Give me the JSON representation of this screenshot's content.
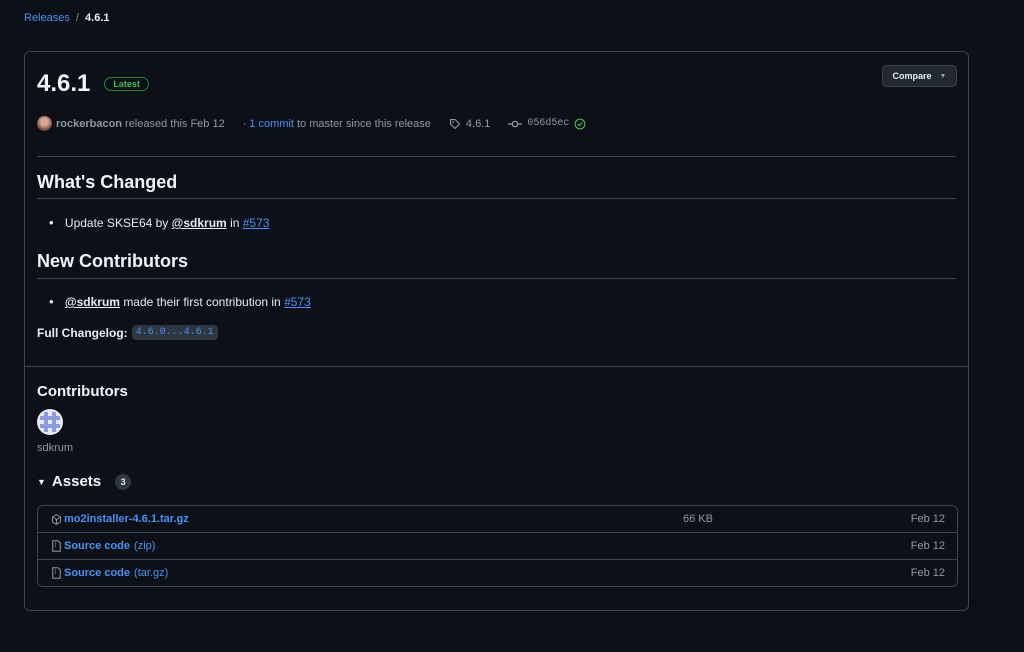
{
  "breadcrumb": {
    "parent": "Releases",
    "separator": "/",
    "current": "4.6.1"
  },
  "release": {
    "title": "4.6.1",
    "badge": "Latest",
    "compare_label": "Compare",
    "author": "rockerbacon",
    "released_text": "released this Feb 12",
    "commits_prefix": "·",
    "commits_link": "1 commit",
    "commits_suffix": "to master since this release",
    "tag": "4.6.1",
    "commit_sha": "056d5ec"
  },
  "notes": {
    "whats_changed_heading": "What's Changed",
    "change_item": {
      "text": "Update SKSE64 by",
      "mention": "@sdkrum",
      "in_text": "in",
      "pr": "#573"
    },
    "new_contributors_heading": "New Contributors",
    "contributor_item": {
      "mention": "@sdkrum",
      "text": "made their first contribution in",
      "pr": "#573"
    },
    "full_changelog_label": "Full Changelog:",
    "full_changelog_link": "4.6.0...4.6.1"
  },
  "contributors": {
    "heading": "Contributors",
    "names": [
      "sdkrum"
    ]
  },
  "assets": {
    "heading": "Assets",
    "count": "3",
    "items": [
      {
        "icon": "package-icon",
        "name": "mo2installer-4.6.1.tar.gz",
        "sub": "",
        "size": "66 KB",
        "date": "Feb 12"
      },
      {
        "icon": "file-zip-icon",
        "name": "Source code",
        "sub": "(zip)",
        "size": "",
        "date": "Feb 12"
      },
      {
        "icon": "file-zip-icon",
        "name": "Source code",
        "sub": "(tar.gz)",
        "size": "",
        "date": "Feb 12"
      }
    ]
  },
  "colors": {
    "background": "#0d1117",
    "link": "#4493f8",
    "latest_badge": "#3fb950",
    "border": "#3d444d",
    "muted": "#9198a1"
  }
}
